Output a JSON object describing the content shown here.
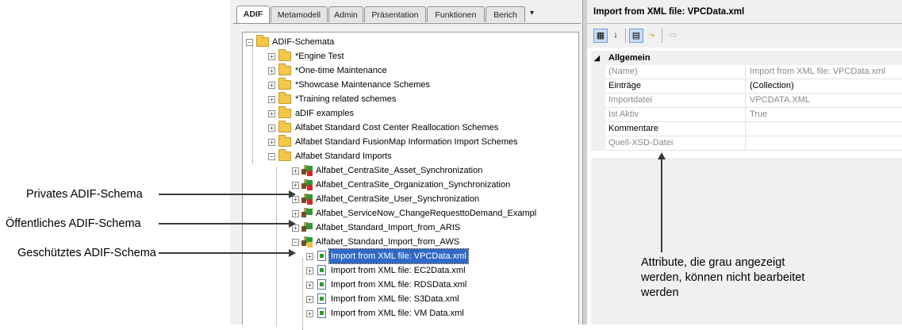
{
  "tabs": [
    "ADIF",
    "Metamodell",
    "Admin",
    "Präsentation",
    "Funktionen",
    "Berich"
  ],
  "tree": {
    "root": "ADIF-Schemata",
    "folders": [
      "*Engine Test",
      "*One-time Maintenance",
      "*Showcase Maintenance Schemes",
      "*Training related schemes",
      "aDIF examples",
      "Alfabet Standard Cost Center Reallocation Schemes",
      "Alfabet Standard FusionMap Information Import Schemes",
      "Alfabet Standard Imports"
    ],
    "schemas": [
      "Alfabet_CentraSite_Asset_Synchronization",
      "Alfabet_CentraSite_Organization_Synchronization",
      "Alfabet_CentraSite_User_Synchronization",
      "Alfabet_ServiceNow_ChangeRequesttoDemand_Exampl",
      "Alfabet_Standard_Import_from_ARIS",
      "Alfabet_Standard_Import_from_AWS"
    ],
    "imports": [
      "Import from XML file: VPCData.xml",
      "Import from XML file: EC2Data.xml",
      "Import from XML file: RDSData.xml",
      "Import from XML file: S3Data.xml",
      "Import from XML file: VM Data.xml"
    ]
  },
  "properties": {
    "title": "Import from XML file: VPCData.xml",
    "section": "Allgemein",
    "rows": [
      {
        "name": "(Name)",
        "value": "Import from XML file: VPCData.xml",
        "readonly": true
      },
      {
        "name": "Einträge",
        "value": "(Collection)",
        "readonly": false
      },
      {
        "name": "Importdatei",
        "value": "VPCDATA.XML",
        "readonly": true
      },
      {
        "name": "Ist Aktiv",
        "value": "True",
        "readonly": true
      },
      {
        "name": "Kommentare",
        "value": "",
        "readonly": false
      },
      {
        "name": "Quell-XSD-Datei",
        "value": "",
        "readonly": true
      }
    ]
  },
  "callouts": {
    "private": "Privates ADIF-Schema",
    "public": "Öffentliches ADIF-Schema",
    "protected": "Geschütztes ADIF-Schema",
    "note_line1": "Attribute, die grau angezeigt",
    "note_line2": "werden,  können nicht bearbeitet",
    "note_line3": "werden"
  },
  "colors": {
    "selection": "#3169c6",
    "private_mark": "#d7262b",
    "protected_mark": "#f0c038",
    "schema_green": "#2f9a32",
    "folder": "#f3c849"
  },
  "icons": {
    "sort_categorized": "categorized-icon",
    "sort_alpha": "alphabetical-sort-icon",
    "properties": "properties-icon",
    "events": "lightning-icon",
    "property_pages": "property-pages-icon"
  }
}
